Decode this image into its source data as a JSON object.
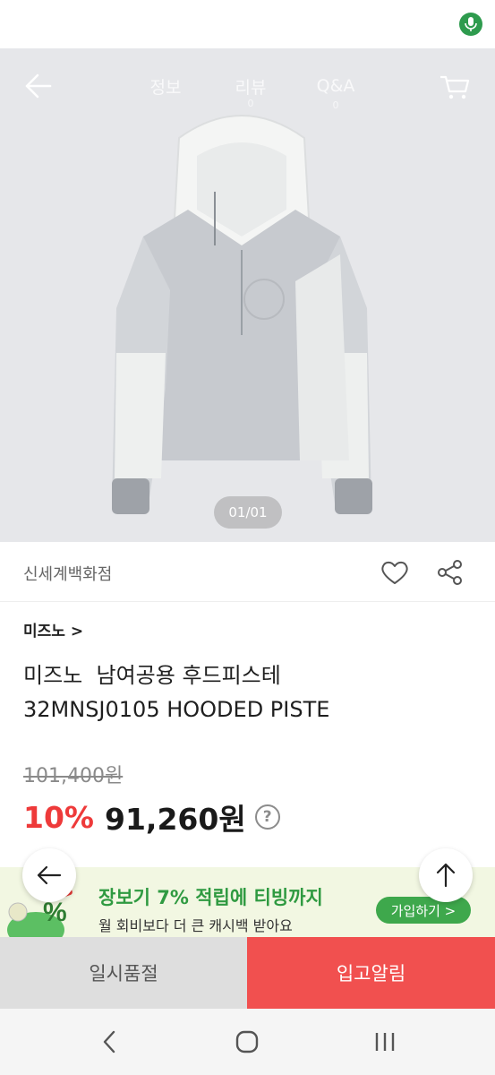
{
  "status_bar": {
    "mic_icon": "microphone-icon",
    "mic_color": "#2e9b4e"
  },
  "top_nav": {
    "back_icon": "back-arrow-icon",
    "tabs": [
      {
        "label": "정보",
        "sub": ""
      },
      {
        "label": "리뷰",
        "sub": "0"
      },
      {
        "label": "Q&A",
        "sub": "0"
      }
    ],
    "cart_icon": "cart-icon"
  },
  "gallery": {
    "counter": "01/01"
  },
  "store": {
    "name": "신세계백화점",
    "heart_icon": "heart-icon",
    "share_icon": "share-icon"
  },
  "product": {
    "brand_link": "미즈노 >",
    "title_line1": "미즈노  남여공용 후드피스테",
    "title_line2": "32MNSJ0105 HOODED PISTE",
    "original_price": "101,400원",
    "discount": "10%",
    "final_price": "91,260원",
    "help_label": "?"
  },
  "banner": {
    "title": "장보기 7% 적립에 티빙까지",
    "subtitle": "월 회비보다 더 큰 캐시백 받아요",
    "join_label": "가입하기 >",
    "accent": "#3ea84c"
  },
  "fab": {
    "left_icon": "left-arrow-icon",
    "up_icon": "up-arrow-icon"
  },
  "actions": {
    "soldout_label": "일시품절",
    "restock_label": "입고알림",
    "restock_color": "#f1504f"
  },
  "system_nav": {
    "back_icon": "nav-back-icon",
    "home_icon": "nav-home-icon",
    "recents_icon": "nav-recents-icon"
  }
}
